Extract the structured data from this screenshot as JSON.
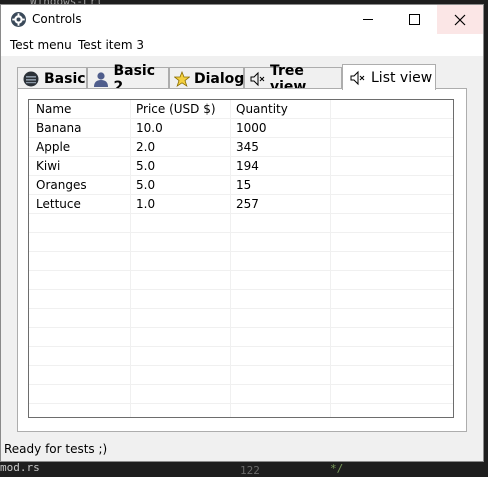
{
  "window": {
    "title": "Controls",
    "icon": "gear-icon"
  },
  "menu": [
    "Test menu",
    "Test item 3"
  ],
  "tabs": [
    {
      "label": "Basic",
      "icon": "disk-icon"
    },
    {
      "label": "Basic 2",
      "icon": "user-icon"
    },
    {
      "label": "Dialog",
      "icon": "star-icon"
    },
    {
      "label": "Tree view",
      "icon": "speaker-icon"
    },
    {
      "label": "List view",
      "icon": "speaker-icon",
      "selected": true
    }
  ],
  "listview": {
    "columns": [
      "Name",
      "Price (USD $)",
      "Quantity",
      ""
    ],
    "rows": [
      [
        "Banana",
        "10.0",
        "1000"
      ],
      [
        "Apple",
        "2.0",
        "345"
      ],
      [
        "Kiwi",
        "5.0",
        "194"
      ],
      [
        "Oranges",
        "5.0",
        "15"
      ],
      [
        "Lettuce",
        "1.0",
        "257"
      ]
    ]
  },
  "status": "Ready for tests ;)",
  "background": {
    "top_snippet": "Windows-Lrl",
    "left_snippet": "mod.rs",
    "mid_snippet": "122",
    "right_snippet": "*/"
  },
  "colors": {
    "close_hover": "#fbe6e6",
    "window_bg": "#f0f0f0"
  }
}
